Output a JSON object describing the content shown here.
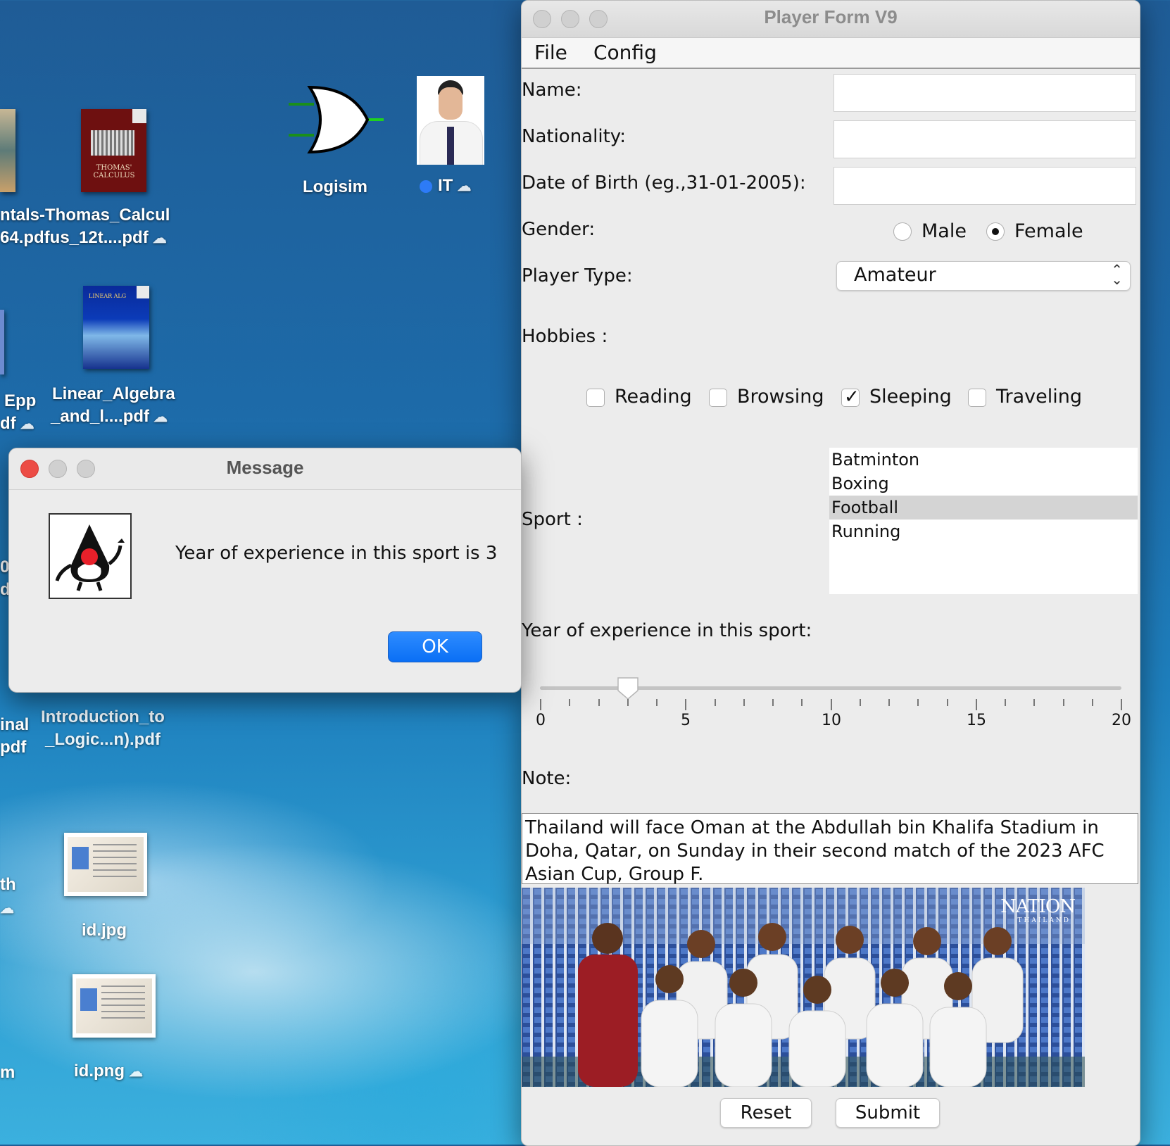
{
  "desktop": {
    "icons": [
      {
        "label_lines": [
          "ntals-Thomas_Calcul",
          "64.pdfus_12t....pdf"
        ]
      },
      {
        "label_lines": [
          "Logisim"
        ]
      },
      {
        "label_lines": [
          "IT"
        ]
      },
      {
        "label_lines": [
          "Epp",
          "df"
        ]
      },
      {
        "label_lines": [
          "Linear_Algebra",
          "_and_l....pdf"
        ]
      },
      {
        "label_lines": [
          "Introduction_to",
          "_Logic...n).pdf"
        ]
      },
      {
        "label_lines": [
          "inal",
          "pdf"
        ]
      },
      {
        "label_lines": [
          "th"
        ]
      },
      {
        "label_lines": [
          "id.jpg"
        ]
      },
      {
        "label_lines": [
          "id.png"
        ]
      },
      {
        "label_lines": [
          "m"
        ]
      },
      {
        "label_lines": [
          "0",
          "d"
        ]
      }
    ],
    "book_text": {
      "calculus": "THOMAS' CALCULUS",
      "linear_algebra": "LINEAR ALG"
    }
  },
  "player_window": {
    "title": "Player Form V9",
    "menu": [
      "File",
      "Config"
    ],
    "fields": {
      "name_label": "Name:",
      "name_value": "",
      "nationality_label": "Nationality:",
      "nationality_value": "",
      "dob_label": "Date of Birth (eg.,31-01-2005):",
      "dob_value": "",
      "gender_label": "Gender:",
      "gender_options": [
        "Male",
        "Female"
      ],
      "gender_selected": "Female",
      "player_type_label": "Player Type:",
      "player_type_value": "Amateur",
      "hobbies_label": "Hobbies :",
      "hobbies": [
        {
          "label": "Reading",
          "checked": false
        },
        {
          "label": "Browsing",
          "checked": false
        },
        {
          "label": "Sleeping",
          "checked": true
        },
        {
          "label": "Traveling",
          "checked": false
        }
      ],
      "sport_label": "Sport :",
      "sports": [
        "Batminton",
        "Boxing",
        "Football",
        "Running"
      ],
      "sport_selected": "Football",
      "experience_label": "Year of experience in this sport:",
      "experience_value": 3,
      "experience_min": 0,
      "experience_max": 20,
      "slider_labels": [
        "0",
        "5",
        "10",
        "15",
        "20"
      ],
      "note_label": "Note:",
      "note_text": "Thailand will face Oman at the Abdullah bin Khalifa Stadium in Doha, Qatar, on Sunday in their second match of the 2023 AFC Asian Cup, Group F.",
      "photo_watermark": "NATION",
      "photo_watermark_sub": "THAILAND"
    },
    "buttons": {
      "reset": "Reset",
      "submit": "Submit"
    }
  },
  "dialog": {
    "title": "Message",
    "message": "Year of experience in this sport is 3",
    "ok": "OK"
  },
  "colors": {
    "accent": "#0a6ff5",
    "close_red": "#ec4c45"
  }
}
